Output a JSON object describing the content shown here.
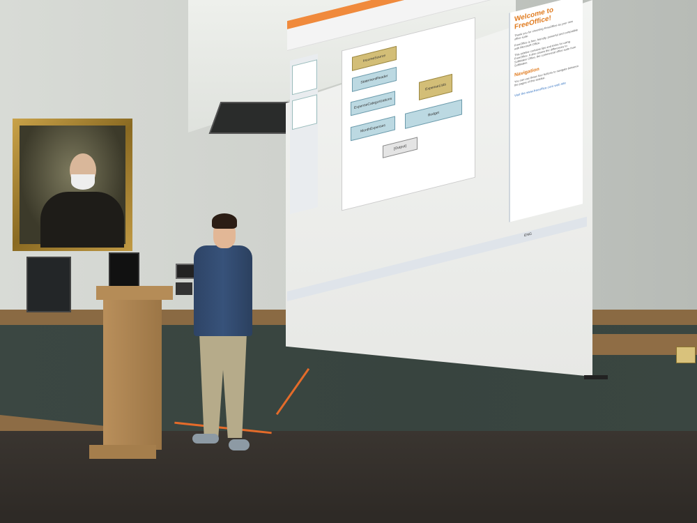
{
  "slide": {
    "box_top": "IncomeSource",
    "box_statement": "StatementReader",
    "box_expense_categories": "ExpenseCategorizations",
    "box_expense_list": "ExpenseLists",
    "box_month": "MonthExpenses",
    "box_budget": "Budget",
    "box_output": "[Output]"
  },
  "panel": {
    "title": "Welcome to FreeOffice!",
    "intro": "Thank you for choosing FreeOffice as your new office suite.",
    "body1": "FreeOffice is free, friendly, powerful and compatible with Microsoft Office.",
    "body2": "This sidebar contains tips and tricks for using FreeOffice. It also shows the differences to SoftMaker Office, the commercial office suite from SoftMaker.",
    "nav_heading": "Navigation",
    "nav_text": "You can use these four buttons to navigate between the pages of this sidebar.",
    "footer_link": "Visit the www.freeoffice.com web site"
  },
  "taskbar": {
    "lang": "ENG"
  }
}
